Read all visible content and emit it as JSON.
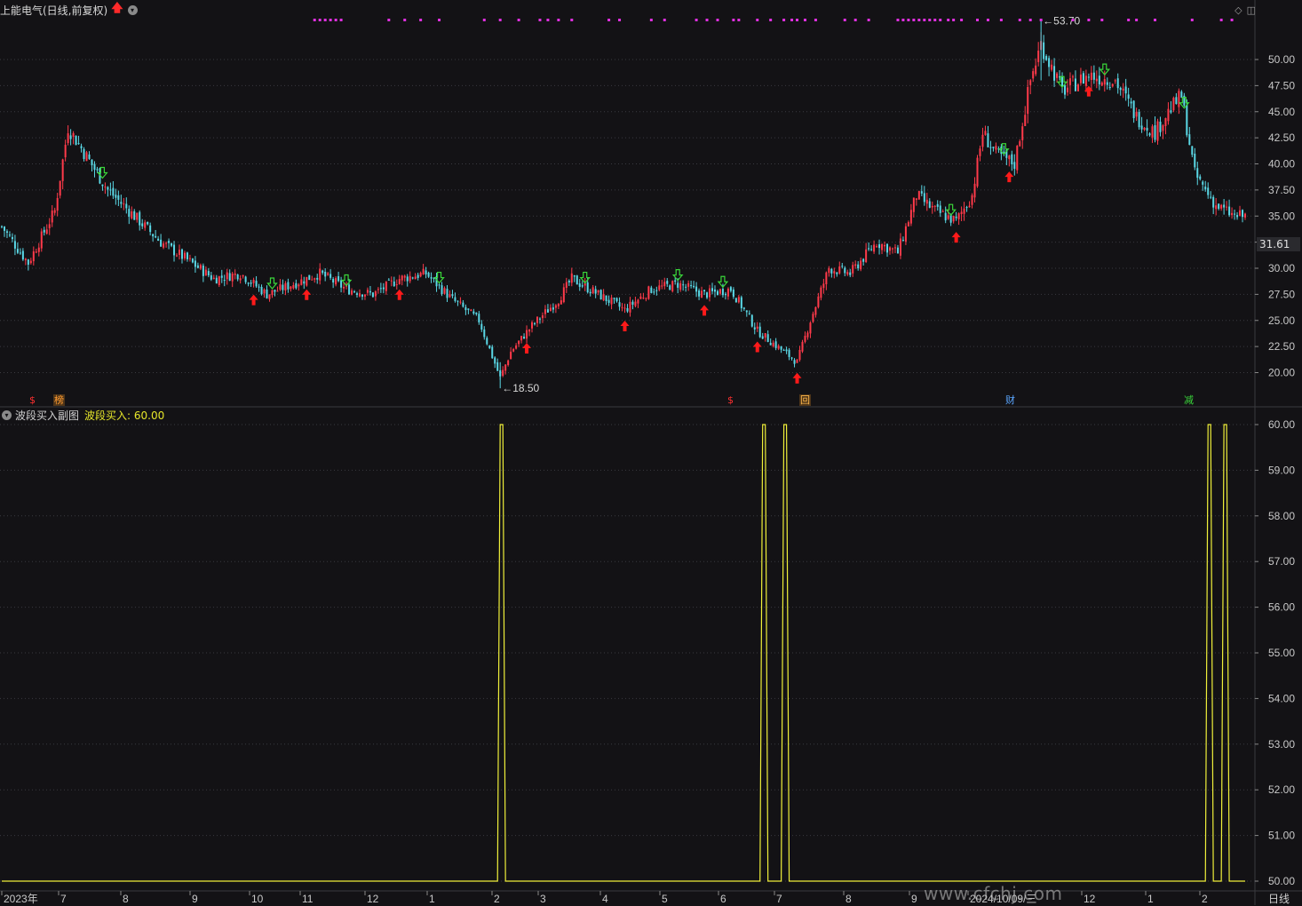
{
  "header": {
    "title": "上能电气(日线,前复权)",
    "up_arrow": "🡅",
    "menu_icon": "chevron-down-icon"
  },
  "corner": {
    "diamond_icon": "◇",
    "panel_icon": "◫"
  },
  "subchart": {
    "title": "波段买入副图",
    "indicator_label": "波段买入: 60.00",
    "menu_icon": "chevron-down-icon"
  },
  "current_price_tag": "31.61",
  "period_label": "日线",
  "watermark": "www.cfchj.com",
  "annotations": {
    "high_label": "53.70",
    "low_label": "18.50"
  },
  "event_badges": [
    {
      "text": "$",
      "color": "#ff3030"
    },
    {
      "text": "榜",
      "color": "#ff9a30"
    },
    {
      "text": "$",
      "color": "#ff3030"
    },
    {
      "text": "回",
      "color": "#ffb84a"
    },
    {
      "text": "财",
      "color": "#5aa6ff"
    },
    {
      "text": "减",
      "color": "#3ad63a"
    }
  ],
  "chart_data": [
    {
      "type": "candlestick",
      "title": "上能电气(日线,前复权)",
      "ylim": [
        18,
        54
      ],
      "y_ticks": [
        "50.00",
        "47.50",
        "45.00",
        "42.50",
        "40.00",
        "37.50",
        "35.00",
        "32.50",
        "30.00",
        "27.50",
        "25.00",
        "22.50",
        "20.00"
      ],
      "x_ticks": [
        "2023年",
        "7",
        "8",
        "9",
        "10",
        "11",
        "12",
        "1",
        "2",
        "3",
        "4",
        "5",
        "6",
        "7",
        "8",
        "9",
        "2024/10/09/三",
        "12",
        "1",
        "2"
      ],
      "up_color": "#ff3a4a",
      "down_color": "#5ad8e6",
      "signal_up_color": "#ff1a1a",
      "signal_down_color": "#3ad63a",
      "close_path": [
        {
          "i": 0,
          "v": 34.0
        },
        {
          "i": 10,
          "v": 30.5
        },
        {
          "i": 20,
          "v": 35.5
        },
        {
          "i": 25,
          "v": 43.5
        },
        {
          "i": 30,
          "v": 41.5
        },
        {
          "i": 40,
          "v": 37.5
        },
        {
          "i": 50,
          "v": 35.0
        },
        {
          "i": 60,
          "v": 32.5
        },
        {
          "i": 70,
          "v": 30.8
        },
        {
          "i": 80,
          "v": 29.0
        },
        {
          "i": 90,
          "v": 29.5
        },
        {
          "i": 100,
          "v": 27.5
        },
        {
          "i": 110,
          "v": 28.5
        },
        {
          "i": 120,
          "v": 29.5
        },
        {
          "i": 130,
          "v": 28.0
        },
        {
          "i": 140,
          "v": 27.5
        },
        {
          "i": 150,
          "v": 29.0
        },
        {
          "i": 160,
          "v": 29.5
        },
        {
          "i": 170,
          "v": 27.0
        },
        {
          "i": 180,
          "v": 25.0
        },
        {
          "i": 188,
          "v": 19.5
        },
        {
          "i": 192,
          "v": 22.0
        },
        {
          "i": 200,
          "v": 24.5
        },
        {
          "i": 210,
          "v": 27.0
        },
        {
          "i": 215,
          "v": 29.0
        },
        {
          "i": 225,
          "v": 27.5
        },
        {
          "i": 235,
          "v": 26.0
        },
        {
          "i": 245,
          "v": 28.0
        },
        {
          "i": 255,
          "v": 28.5
        },
        {
          "i": 265,
          "v": 27.5
        },
        {
          "i": 275,
          "v": 28.0
        },
        {
          "i": 285,
          "v": 24.0
        },
        {
          "i": 295,
          "v": 22.0
        },
        {
          "i": 300,
          "v": 21.0
        },
        {
          "i": 305,
          "v": 25.0
        },
        {
          "i": 312,
          "v": 30.0
        },
        {
          "i": 320,
          "v": 29.5
        },
        {
          "i": 330,
          "v": 32.5
        },
        {
          "i": 338,
          "v": 31.5
        },
        {
          "i": 345,
          "v": 37.0
        },
        {
          "i": 352,
          "v": 35.5
        },
        {
          "i": 360,
          "v": 34.5
        },
        {
          "i": 366,
          "v": 37.0
        },
        {
          "i": 370,
          "v": 43.0
        },
        {
          "i": 375,
          "v": 41.0
        },
        {
          "i": 382,
          "v": 40.0
        },
        {
          "i": 388,
          "v": 48.0
        },
        {
          "i": 392,
          "v": 51.5
        },
        {
          "i": 400,
          "v": 47.0
        },
        {
          "i": 410,
          "v": 48.5
        },
        {
          "i": 420,
          "v": 48.0
        },
        {
          "i": 428,
          "v": 44.5
        },
        {
          "i": 435,
          "v": 43.0
        },
        {
          "i": 440,
          "v": 45.0
        },
        {
          "i": 445,
          "v": 46.5
        },
        {
          "i": 450,
          "v": 39.0
        },
        {
          "i": 458,
          "v": 36.0
        },
        {
          "i": 465,
          "v": 35.0
        }
      ],
      "high_marker": 53.7,
      "low_marker": 18.5,
      "last_price": 31.61,
      "buy_signal_bars": [
        95,
        115,
        150,
        198,
        235,
        265,
        285,
        300,
        360,
        380,
        410
      ],
      "sell_signal_bars": [
        38,
        102,
        130,
        165,
        220,
        255,
        272,
        358,
        378,
        400,
        416,
        446
      ]
    },
    {
      "type": "line",
      "title": "波段买入副图",
      "series": [
        {
          "name": "波段买入",
          "color": "#f0f03a"
        }
      ],
      "ylim": [
        50,
        60
      ],
      "y_ticks": [
        "60.00",
        "59.00",
        "58.00",
        "57.00",
        "56.00",
        "55.00",
        "54.00",
        "53.00",
        "52.00",
        "51.00",
        "50.00"
      ],
      "baseline": 50,
      "spike_value": 60,
      "spike_bars": [
        188,
        287,
        295,
        455,
        461
      ]
    }
  ]
}
